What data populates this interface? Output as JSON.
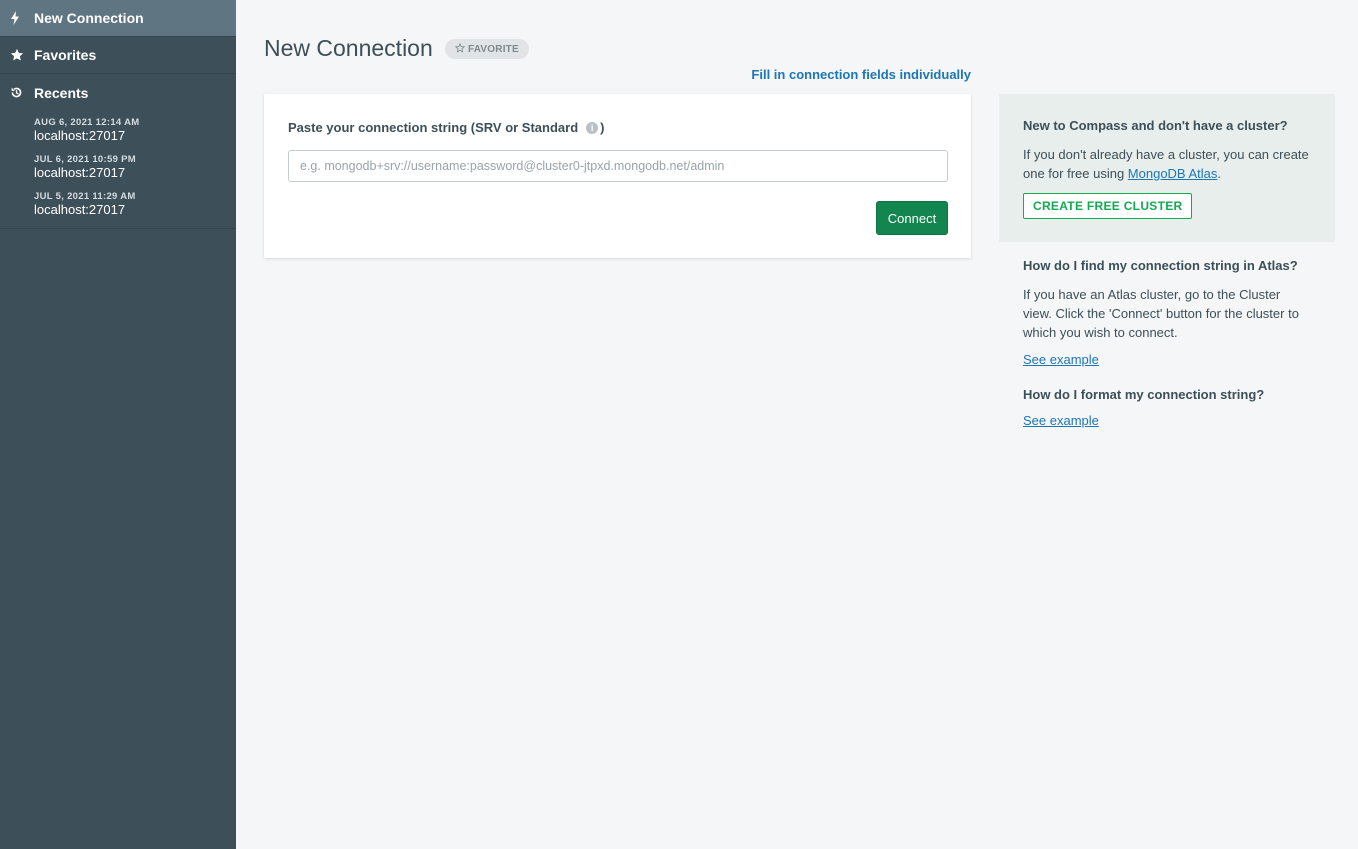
{
  "sidebar": {
    "new_connection": "New Connection",
    "favorites": "Favorites",
    "recents": "Recents",
    "recent_items": [
      {
        "date": "AUG 6, 2021 12:14 AM",
        "host": "localhost:27017"
      },
      {
        "date": "JUL 6, 2021 10:59 PM",
        "host": "localhost:27017"
      },
      {
        "date": "JUL 5, 2021 11:29 AM",
        "host": "localhost:27017"
      }
    ]
  },
  "header": {
    "title": "New Connection",
    "favorite_label": "FAVORITE",
    "fill_fields_link": "Fill in connection fields individually"
  },
  "form": {
    "label": "Paste your connection string (SRV or Standard",
    "label_close": ")",
    "info_glyph": "i",
    "placeholder": "e.g. mongodb+srv://username:password@cluster0-jtpxd.mongodb.net/admin",
    "value": "",
    "connect_label": "Connect"
  },
  "help": {
    "cluster_heading": "New to Compass and don't have a cluster?",
    "cluster_text_before": "If you don't already have a cluster, you can create one for free using ",
    "cluster_link": "MongoDB Atlas",
    "cluster_text_after": ".",
    "cluster_button": "CREATE FREE CLUSTER",
    "atlas_heading": "How do I find my connection string in Atlas?",
    "atlas_text": "If you have an Atlas cluster, go to the Cluster view. Click the 'Connect' button for the cluster to which you wish to connect.",
    "atlas_link": "See example",
    "format_heading": "How do I format my connection string?",
    "format_link": "See example"
  },
  "colors": {
    "sidebar_bg": "#3d4f58",
    "sidebar_active": "#5f7581",
    "primary_green": "#13854e",
    "link_blue": "#1d76b6",
    "cluster_green": "#13aa52"
  },
  "icons": {
    "new_connection": "lightning-icon",
    "favorites": "star-icon",
    "recents": "history-icon",
    "favorite_badge": "star-outline-icon",
    "info": "info-icon"
  }
}
